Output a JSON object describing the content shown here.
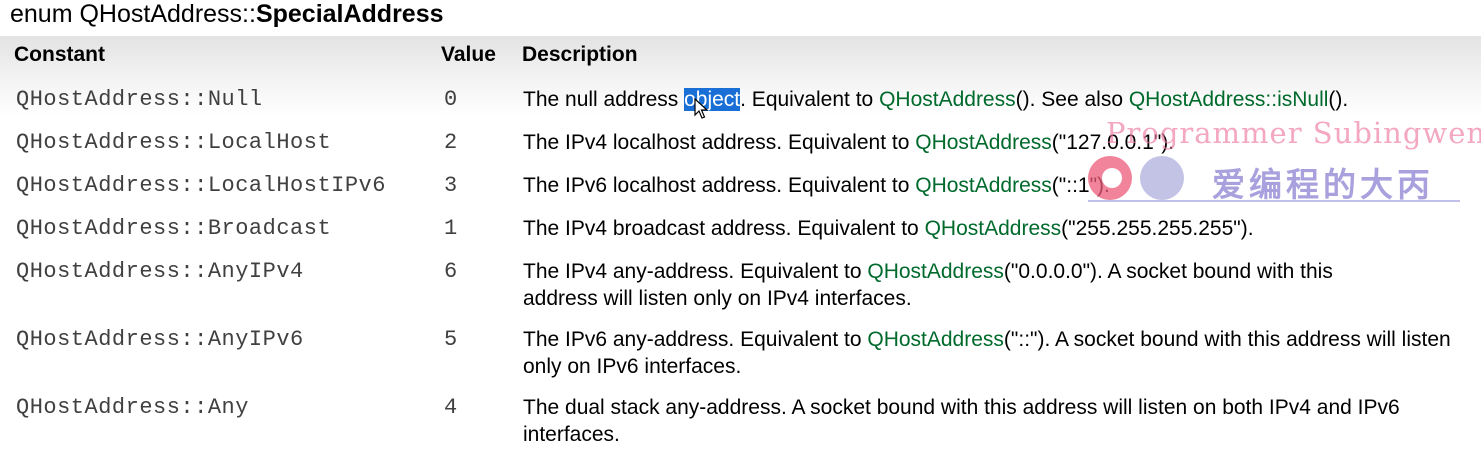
{
  "title": {
    "prefix": "enum QHostAddress::",
    "name": "SpecialAddress"
  },
  "columns": {
    "constant": "Constant",
    "value": "Value",
    "description": "Description"
  },
  "rows": [
    {
      "constant": "QHostAddress::Null",
      "value": "0",
      "d": [
        "The null address ",
        "object",
        ". Equivalent to ",
        "QHostAddress",
        "(). See also ",
        "QHostAddress::isNull",
        "()."
      ]
    },
    {
      "constant": "QHostAddress::LocalHost",
      "value": "2",
      "d": [
        "The IPv4 localhost address. Equivalent to ",
        "QHostAddress",
        "(\"127.0.0.1\")."
      ]
    },
    {
      "constant": "QHostAddress::LocalHostIPv6",
      "value": "3",
      "d": [
        "The IPv6 localhost address. Equivalent to ",
        "QHostAddress",
        "(\"::1\")."
      ]
    },
    {
      "constant": "QHostAddress::Broadcast",
      "value": "1",
      "d": [
        "The IPv4 broadcast address. Equivalent to ",
        "QHostAddress",
        "(\"255.255.255.255\")."
      ]
    },
    {
      "constant": "QHostAddress::AnyIPv4",
      "value": "6",
      "d": [
        "The IPv4 any-address. Equivalent to ",
        "QHostAddress",
        "(\"0.0.0.0\"). A socket bound with this address will listen only on IPv4 interfaces."
      ]
    },
    {
      "constant": "QHostAddress::AnyIPv6",
      "value": "5",
      "d": [
        "The IPv6 any-address. Equivalent to ",
        "QHostAddress",
        "(\"::\"). A socket bound with this address will listen only on IPv6 interfaces."
      ]
    },
    {
      "constant": "QHostAddress::Any",
      "value": "4",
      "d": [
        "The dual stack any-address. A socket bound with this address will listen on both IPv4 and IPv6 interfaces."
      ]
    }
  ],
  "watermark": {
    "top": "Programmer Subingwen.cn",
    "bottom": "爱编程的大丙",
    "icons": [
      "avatar-logo-icon",
      "circle-logo-icon"
    ]
  },
  "colors": {
    "link": "#006a2c",
    "selection": "#1a6fd6",
    "header_band": "#e3e3e3"
  },
  "cursor_icon": "arrow-cursor-icon"
}
